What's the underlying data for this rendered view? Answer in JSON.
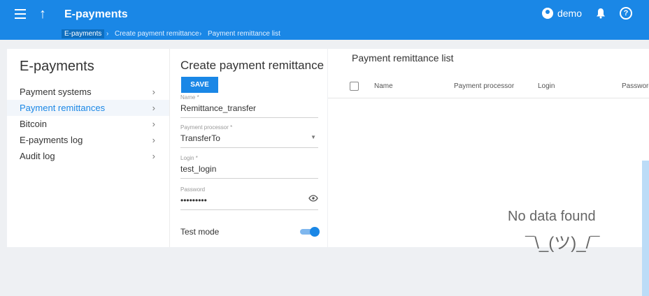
{
  "header": {
    "title": "E-payments",
    "user": "demo"
  },
  "breadcrumb": [
    "E-payments",
    "Create payment remittance",
    "Payment remittance list"
  ],
  "sidebar": {
    "title": "E-payments",
    "items": [
      {
        "label": "Payment systems",
        "active": false
      },
      {
        "label": "Payment remittances",
        "active": true
      },
      {
        "label": "Bitcoin",
        "active": false
      },
      {
        "label": "E-payments log",
        "active": false
      },
      {
        "label": "Audit log",
        "active": false
      }
    ]
  },
  "form": {
    "title": "Create payment remittance",
    "save_label": "SAVE",
    "fields": [
      {
        "label": "Name *",
        "value": "Remittance_transfer"
      },
      {
        "label": "Payment processor *",
        "value": "TransferTo"
      },
      {
        "label": "Login *",
        "value": "test_login"
      },
      {
        "label": "Password",
        "value": "•••••••••"
      }
    ],
    "test_mode_label": "Test mode",
    "test_mode": true
  },
  "list": {
    "title": "Payment remittance list",
    "columns": [
      "Name",
      "Payment processor",
      "Login",
      "Password"
    ],
    "empty_text": "No data found",
    "shrug": "¯\\_(ツ)_/¯"
  }
}
